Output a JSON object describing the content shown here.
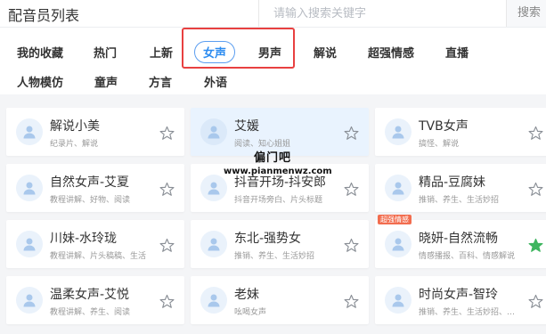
{
  "header": {
    "title": "配音员列表",
    "search_placeholder": "请输入搜索关键字",
    "search_button": "搜索"
  },
  "categories": [
    "我的收藏",
    "热门",
    "上新",
    "女声",
    "男声",
    "解说",
    "超强情感",
    "直播",
    "人物模仿",
    "童声",
    "方言",
    "外语"
  ],
  "active_category": "女声",
  "cards": [
    {
      "name": "解说小美",
      "tags": "纪录片、解说",
      "favorited": false
    },
    {
      "name": "艾媛",
      "tags": "阅读、知心姐姐",
      "favorited": false
    },
    {
      "name": "TVB女声",
      "tags": "搞怪、解说",
      "favorited": false
    },
    {
      "name": "自然女声-艾夏",
      "tags": "教程讲解、好物、阅读",
      "favorited": false
    },
    {
      "name": "抖音开场-抖安郎",
      "tags": "抖音开场旁白、片头标题",
      "favorited": false
    },
    {
      "name": "精品-豆腐妹",
      "tags": "推销、养生、生活妙招",
      "favorited": false
    },
    {
      "name": "川妹-水玲珑",
      "tags": "教程讲解、片头稿稿、生活",
      "favorited": false
    },
    {
      "name": "东北-强势女",
      "tags": "推销、养生、生活妙招",
      "favorited": false
    },
    {
      "name": "晓妍-自然流畅",
      "tags": "情感播报、百科、情感解说",
      "favorited": true,
      "badge": "超强情感"
    },
    {
      "name": "温柔女声-艾悦",
      "tags": "教程讲解、养生、阅读",
      "favorited": false
    },
    {
      "name": "老妹",
      "tags": "吆喝女声",
      "favorited": false
    },
    {
      "name": "时尚女声-智玲",
      "tags": "推销、养生、生活妙招、好物",
      "favorited": false
    }
  ],
  "watermark": {
    "line1": "偏门吧",
    "line2": "www.pianmenwz.com"
  },
  "colors": {
    "accent": "#2d8cf0",
    "star_active": "#3eb55f",
    "annotation": "#e84040",
    "badge": "#f26d4f"
  }
}
